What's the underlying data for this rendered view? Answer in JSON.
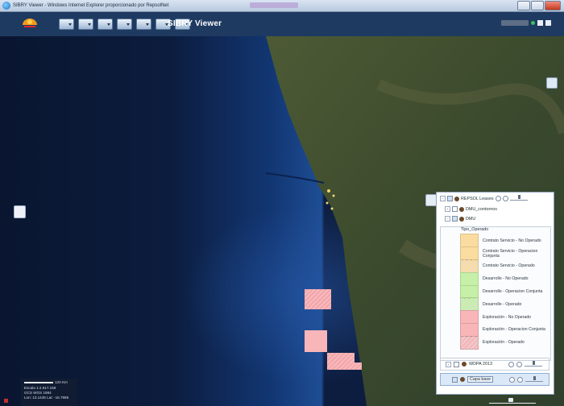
{
  "window": {
    "title": "SIBRY Viewer - Windows Internet Explorer proporcionado por RepsolNet"
  },
  "app": {
    "title": "SIBRY Viewer"
  },
  "toolbar": {
    "tools": [
      "layers-tool",
      "identify-tool",
      "select-tool",
      "measure-tool",
      "print-tool",
      "bookmark-tool",
      "edit-tool"
    ]
  },
  "legend": {
    "layers": [
      {
        "name": "REPSOL Leases",
        "expanded": true,
        "checked": true
      },
      {
        "name": "DMU_contornos",
        "expanded": false,
        "checked": false
      },
      {
        "name": "DMU",
        "expanded": true,
        "checked": true
      }
    ],
    "group_title": "Tipo_Operado",
    "symbols": [
      {
        "label": "Contrato Servicio - No Operado",
        "color": "#fbdca0",
        "hatch": false
      },
      {
        "label": "Contrato Servicio - Operacion Conjunta",
        "color": "#fbdca0",
        "hatch": false
      },
      {
        "label": "Contrato Servicio - Operado",
        "color": "#fbdca0",
        "hatch": true
      },
      {
        "label": "Desarrollo - No Operado",
        "color": "#c6f0a8",
        "hatch": false
      },
      {
        "label": "Desarrollo - Operacion Conjunta",
        "color": "#c6f0a8",
        "hatch": false
      },
      {
        "label": "Desarrollo - Operado",
        "color": "#c6f0a8",
        "hatch": true
      },
      {
        "label": "Exploración - No Operado",
        "color": "#f8b6b9",
        "hatch": false
      },
      {
        "label": "Exploración - Operacion Conjunta",
        "color": "#f8b6b9",
        "hatch": false
      },
      {
        "label": "Exploración - Operado",
        "color": "#f8b6b9",
        "hatch": true
      }
    ],
    "footer_layers": [
      {
        "name": "WDPA 2013",
        "selected": false,
        "boxed": false
      },
      {
        "name": "Capa base",
        "selected": true,
        "boxed": true
      }
    ]
  },
  "scale": {
    "bar_label": "120 Km",
    "scale_text": "Escala 1:4.617.159",
    "crs": "GCS WGS 1984",
    "coords": "Lon: 13.1445   Lat: -16.7995"
  },
  "colors": {
    "toolbar_bg": "#1e3a61",
    "ocean": "#0d1d3f",
    "land": "#3c4a2a",
    "lease": "#f8b6b9"
  }
}
